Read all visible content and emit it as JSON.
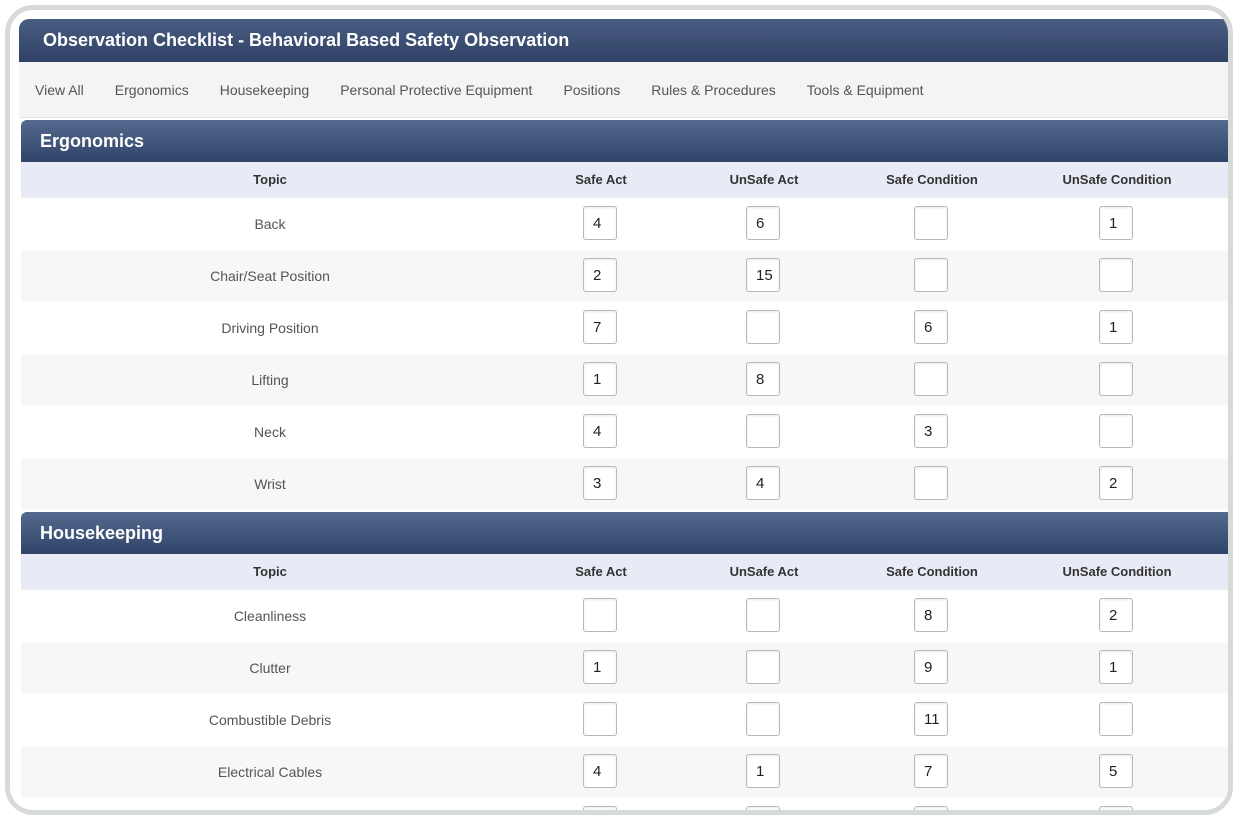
{
  "window": {
    "title": "Observation Checklist - Behavioral Based Safety Observation"
  },
  "tabs": [
    "View All",
    "Ergonomics",
    "Housekeeping",
    "Personal Protective Equipment",
    "Positions",
    "Rules & Procedures",
    "Tools & Equipment"
  ],
  "columns": [
    "Topic",
    "Safe Act",
    "UnSafe Act",
    "Safe Condition",
    "UnSafe Condition"
  ],
  "sections": [
    {
      "title": "Ergonomics",
      "rows": [
        {
          "topic": "Back",
          "values": [
            "4",
            "6",
            "",
            "1"
          ]
        },
        {
          "topic": "Chair/Seat Position",
          "values": [
            "2",
            "15",
            "",
            ""
          ]
        },
        {
          "topic": "Driving Position",
          "values": [
            "7",
            "",
            "6",
            "1"
          ]
        },
        {
          "topic": "Lifting",
          "values": [
            "1",
            "8",
            "",
            ""
          ]
        },
        {
          "topic": "Neck",
          "values": [
            "4",
            "",
            "3",
            ""
          ]
        },
        {
          "topic": "Wrist",
          "values": [
            "3",
            "4",
            "",
            "2"
          ]
        }
      ]
    },
    {
      "title": "Housekeeping",
      "rows": [
        {
          "topic": "Cleanliness",
          "values": [
            "",
            "",
            "8",
            "2"
          ]
        },
        {
          "topic": "Clutter",
          "values": [
            "1",
            "",
            "9",
            "1"
          ]
        },
        {
          "topic": "Combustible Debris",
          "values": [
            "",
            "",
            "11",
            ""
          ]
        },
        {
          "topic": "Electrical Cables",
          "values": [
            "4",
            "1",
            "7",
            "5"
          ]
        },
        {
          "topic": "",
          "values": [
            "",
            "",
            "",
            ""
          ]
        }
      ]
    }
  ]
}
